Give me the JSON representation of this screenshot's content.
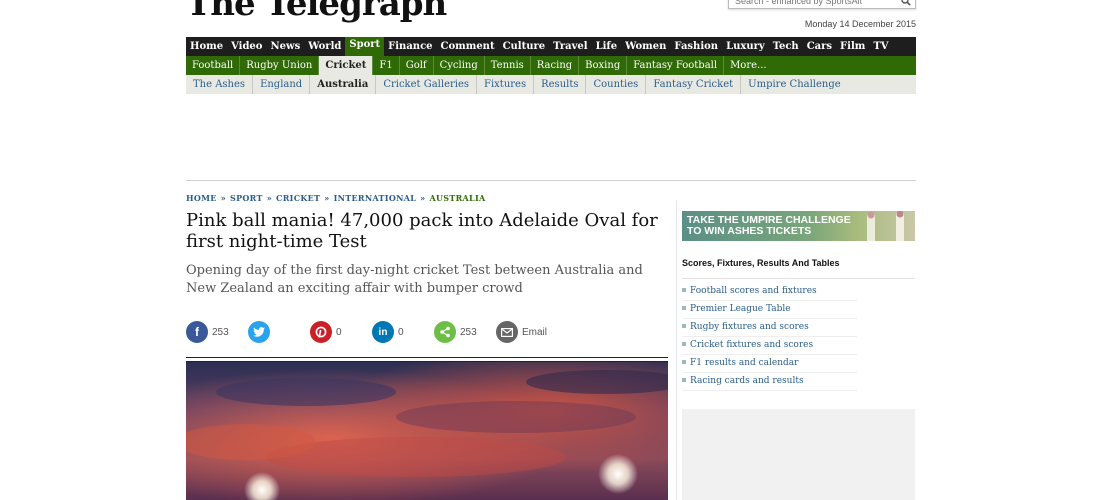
{
  "masthead": {
    "logo": "The Telegraph",
    "search_placeholder": "Search - enhanced by SportsAlt",
    "search_icon": "search-icon",
    "date": "Monday 14 December 2015"
  },
  "nav": {
    "primary": [
      "Home",
      "Video",
      "News",
      "World",
      "Sport",
      "Finance",
      "Comment",
      "Culture",
      "Travel",
      "Life",
      "Women",
      "Fashion",
      "Luxury",
      "Tech",
      "Cars",
      "Film",
      "TV"
    ],
    "primary_active": "Sport",
    "secondary": [
      "Football",
      "Rugby Union",
      "Cricket",
      "F1",
      "Golf",
      "Cycling",
      "Tennis",
      "Racing",
      "Boxing",
      "Fantasy Football",
      "More..."
    ],
    "secondary_active": "Cricket",
    "tertiary": [
      "The Ashes",
      "England",
      "Australia",
      "Cricket Galleries",
      "Fixtures",
      "Results",
      "Counties",
      "Fantasy Cricket",
      "Umpire Challenge"
    ],
    "tertiary_active": "Australia"
  },
  "breadcrumb": {
    "items": [
      "HOME",
      "SPORT",
      "CRICKET",
      "INTERNATIONAL",
      "AUSTRALIA"
    ],
    "separator": "»"
  },
  "article": {
    "headline": "Pink ball mania! 47,000 pack into Adelaide Oval for first night-time Test",
    "standfirst": "Opening day of the first day-night cricket Test between Australia and New Zealand an exciting affair with bumper crowd"
  },
  "share": {
    "facebook": {
      "count": "253",
      "icon": "facebook-icon",
      "color": "#3b5998"
    },
    "twitter": {
      "count": "",
      "icon": "twitter-icon",
      "color": "#2aa3ef"
    },
    "pinterest": {
      "count": "0",
      "icon": "pinterest-icon",
      "color": "#cb2027"
    },
    "linkedin": {
      "count": "0",
      "icon": "linkedin-icon",
      "color": "#0077b5"
    },
    "share": {
      "count": "253",
      "icon": "share-icon",
      "color": "#6cbe45"
    },
    "email": {
      "label": "Email",
      "icon": "email-icon",
      "color": "#666666"
    }
  },
  "sidebar": {
    "promo": "TAKE THE UMPIRE CHALLENGE TO WIN ASHES TICKETS",
    "promo_line1": "TAKE THE UMPIRE CHALLENGE",
    "promo_line2": "TO WIN ASHES TICKETS",
    "title": "Scores, Fixtures, Results And Tables",
    "links": [
      "Football scores and fixtures",
      "Premier League Table",
      "Rugby fixtures and scores",
      "Cricket fixtures and scores",
      "F1 results and calendar",
      "Racing cards and results"
    ]
  },
  "colors": {
    "nav_dark": "#1e1e1e",
    "sport_green": "#2f6a06",
    "link_blue": "#2a5d8c"
  }
}
